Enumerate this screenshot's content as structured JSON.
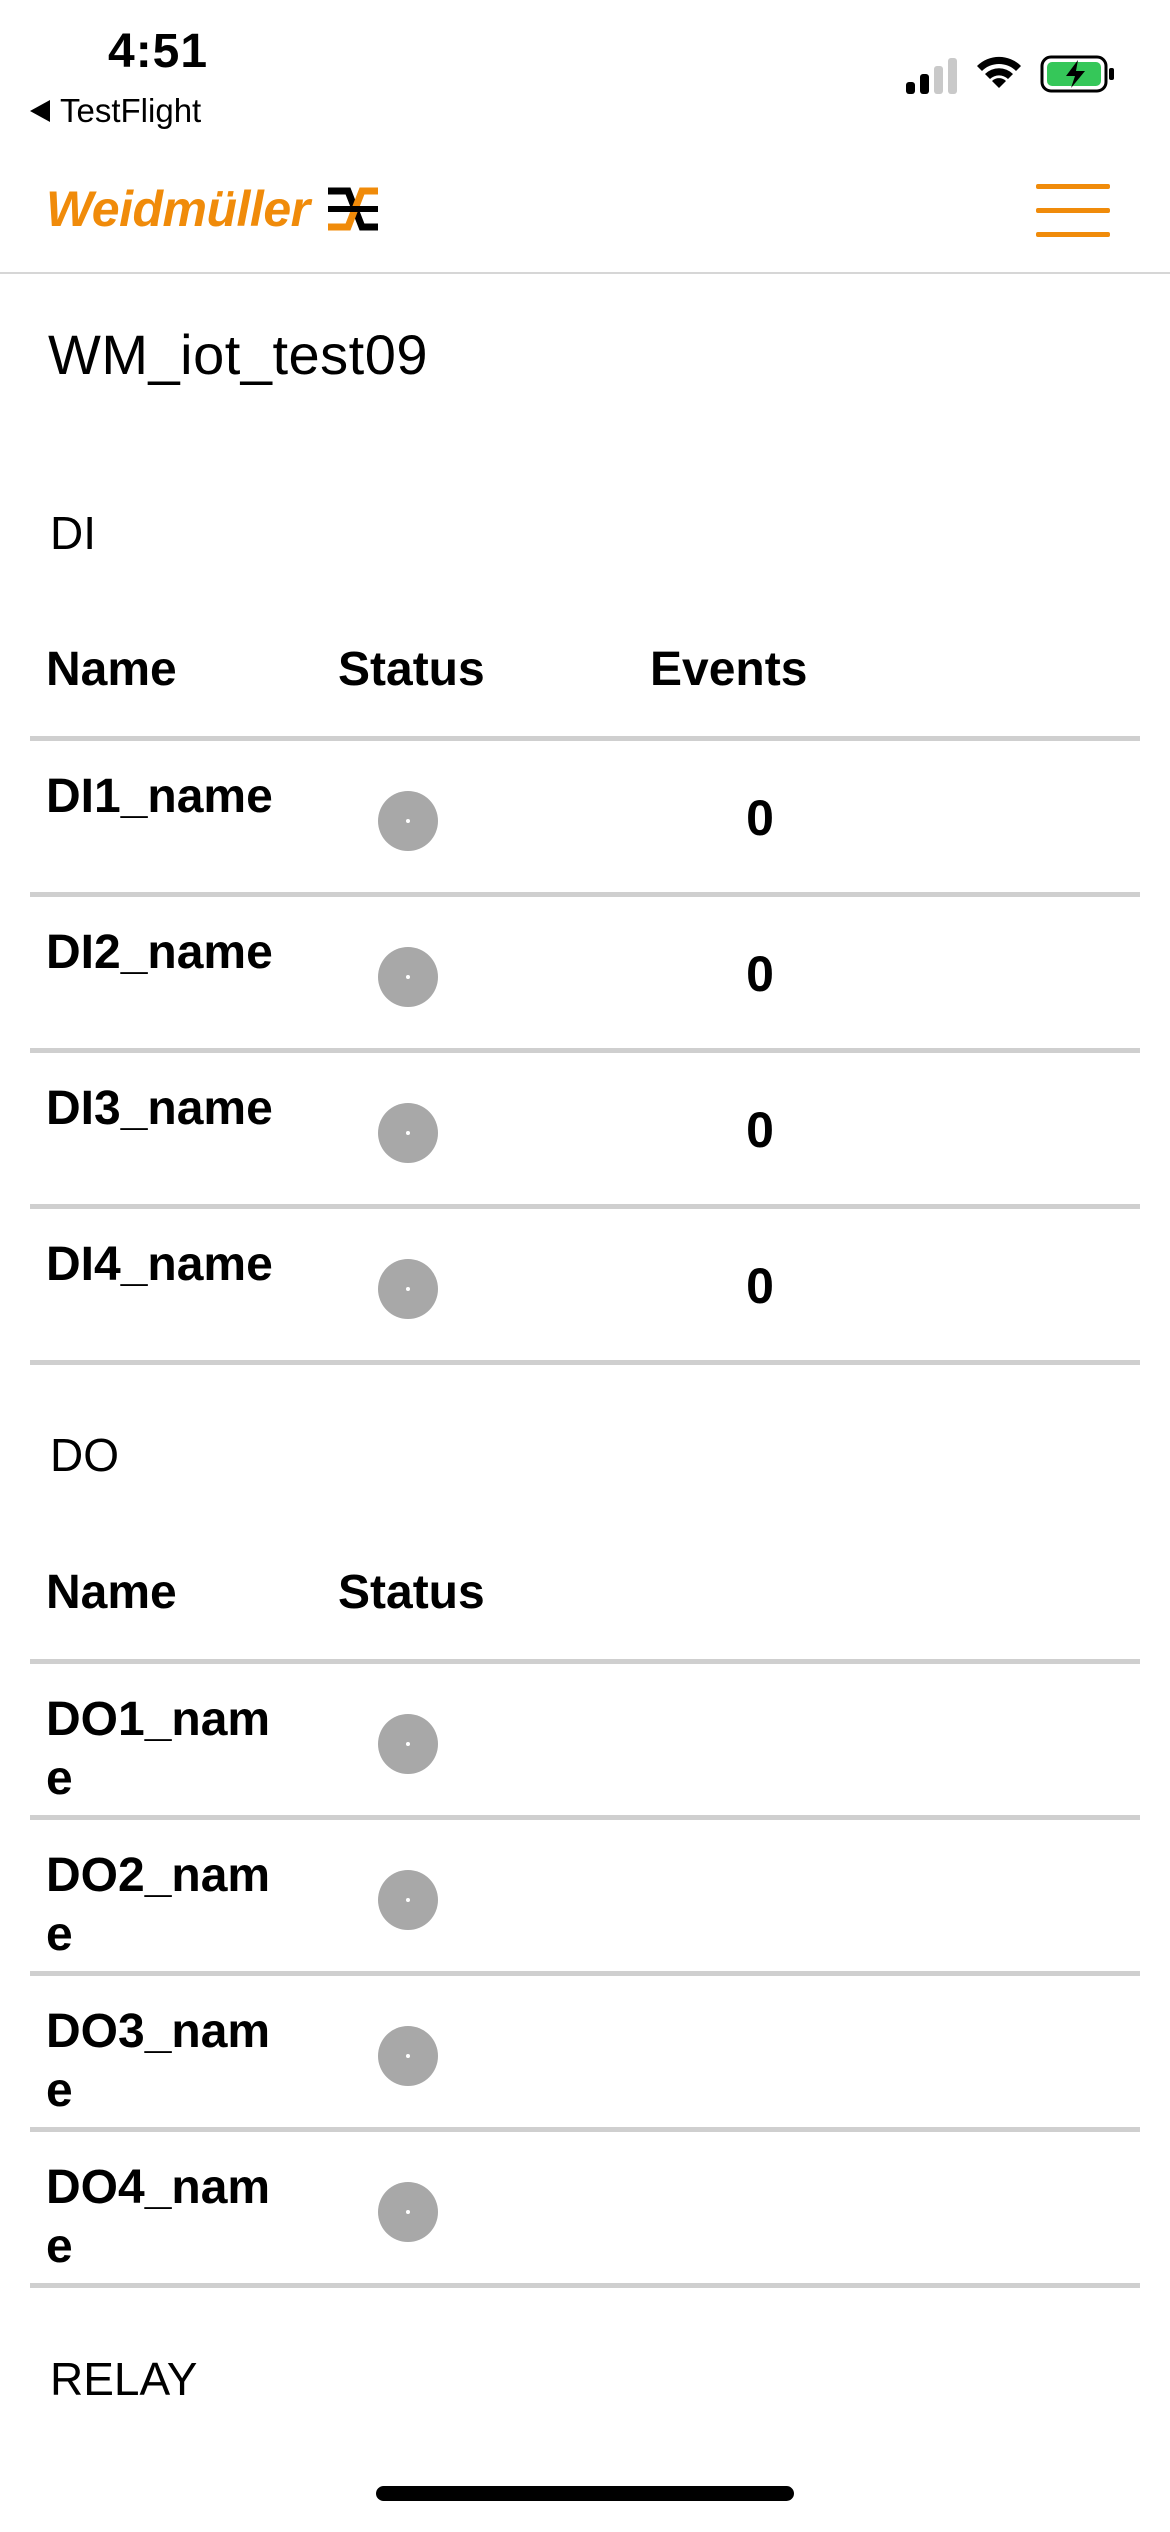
{
  "status_bar": {
    "time": "4:51",
    "back_app": "TestFlight"
  },
  "header": {
    "brand": "Weidmüller",
    "brand_color": "#f08b0a"
  },
  "device": {
    "title": "WM_iot_test09"
  },
  "sections": {
    "di": {
      "label": "DI",
      "columns": {
        "name": "Name",
        "status": "Status",
        "events": "Events"
      },
      "rows": [
        {
          "name": "DI1_name",
          "status": "off",
          "events": "0"
        },
        {
          "name": "DI2_name",
          "status": "off",
          "events": "0"
        },
        {
          "name": "DI3_name",
          "status": "off",
          "events": "0"
        },
        {
          "name": "DI4_name",
          "status": "off",
          "events": "0"
        }
      ]
    },
    "do": {
      "label": "DO",
      "columns": {
        "name": "Name",
        "status": "Status"
      },
      "rows": [
        {
          "name": "DO1_name",
          "status": "off"
        },
        {
          "name": "DO2_name",
          "status": "off"
        },
        {
          "name": "DO3_name",
          "status": "off"
        },
        {
          "name": "DO4_name",
          "status": "off"
        }
      ]
    },
    "relay": {
      "label": "RELAY"
    }
  },
  "colors": {
    "status_off": "#a8a8a8",
    "divider": "#cfcfcf"
  }
}
